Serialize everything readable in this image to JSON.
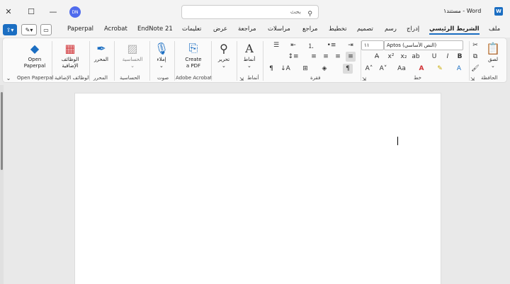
{
  "titlebar": {
    "close_icon": "close-icon",
    "maximize_icon": "maximize-icon",
    "minimize_icon": "minimize-icon",
    "avatar_initials": "DN",
    "search_placeholder": "بحث",
    "doc_title": "مستند١ - Word"
  },
  "tabs": [
    "ملف",
    "الشريط الرئيسي",
    "إدراج",
    "رسم",
    "تصميم",
    "تخطيط",
    "مراجع",
    "مراسلات",
    "مراجعة",
    "عرض",
    "تعليمات",
    "EndNote 21",
    "Acrobat",
    "Paperpal"
  ],
  "active_tab": "الشريط الرئيسي",
  "ribbon": {
    "clipboard": {
      "paste": "لصق",
      "group": "الحافظة"
    },
    "font": {
      "font_name": "Aptos (النص الأساسي)",
      "font_size": "١١",
      "group": "خط"
    },
    "paragraph": {
      "group": "فقرة"
    },
    "styles": {
      "styles_btn": "أنماط",
      "group": "أنماط"
    },
    "editing": {
      "edit_btn": "تحرير"
    },
    "acrobat": {
      "create_pdf_1": "Create",
      "create_pdf_2": "a PDF",
      "group": "Adobe Acrobat"
    },
    "voice": {
      "dictate": "إملاء",
      "group": "صوت"
    },
    "sensitivity": {
      "btn": "الحساسية",
      "group": "الحساسية"
    },
    "editor": {
      "btn": "المحرر",
      "group": "المحرر"
    },
    "addins": {
      "btn_1": "الوظائف",
      "btn_2": "الإضافية",
      "group": "الوظائف الإضافية"
    },
    "paperpal": {
      "btn_1": "Open",
      "btn_2": "Paperpal",
      "group": "Open Paperpal"
    }
  },
  "colors": {
    "accent": "#1b6ec2",
    "font_color": "#d13438",
    "highlight": "#ffe600"
  }
}
